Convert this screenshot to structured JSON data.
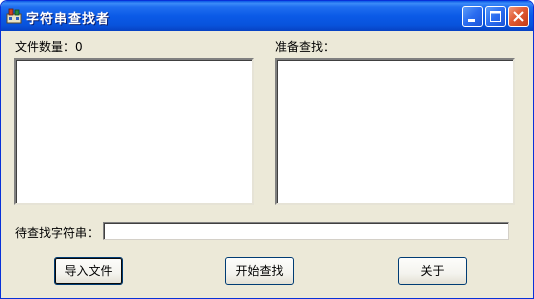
{
  "window": {
    "title": "字符串查找者",
    "controls": [
      "minimize-icon",
      "maximize-icon",
      "close-icon"
    ]
  },
  "left_panel": {
    "label": "文件数量：0",
    "items": []
  },
  "right_panel": {
    "label": "准备查找：",
    "items": []
  },
  "search": {
    "label": "待查找字符串：",
    "value": ""
  },
  "buttons": {
    "import": "导入文件",
    "start": "开始查找",
    "about": "关于"
  },
  "colors": {
    "titlebar": "#0b5ae7",
    "window_bg": "#ece9d8",
    "close_button": "#e05a33"
  }
}
